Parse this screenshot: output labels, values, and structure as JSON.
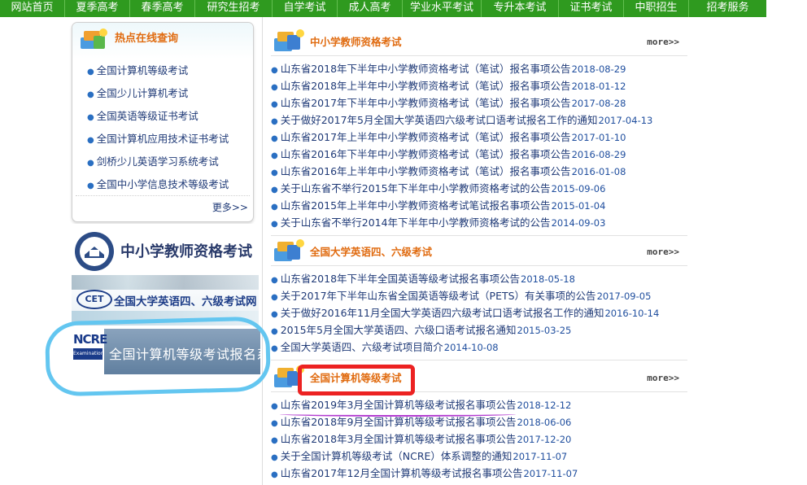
{
  "nav": {
    "items": [
      "网站首页",
      "夏季高考",
      "春季高考",
      "研究生招考",
      "自学考试",
      "成人高考",
      "学业水平考试",
      "专升本考试",
      "证书考试",
      "中职招生",
      "招考服务"
    ]
  },
  "hot": {
    "title": "热点在线查询",
    "items": [
      "全国计算机等级考试",
      "全国少儿计算机考试",
      "全国英语等级证书考试",
      "全国计算机应用技术证书考试",
      "剑桥少儿英语学习系统考试",
      "全国中小学信息技术等级考试"
    ],
    "more": "更多>>"
  },
  "banners": {
    "teacher": "中小学教师资格考试",
    "cet": "全国大学英语四、六级考试网",
    "cet_logo": "CET",
    "ncre": "全国计算机等级考试报名系统",
    "ncre_logo": "NCRE",
    "ncre_logo_sub": "Examination"
  },
  "sections": [
    {
      "title": "中小学教师资格考试",
      "more": "more>>",
      "items": [
        {
          "text": "山东省2018年下半年中小学教师资格考试（笔试）报名事项公告",
          "date": "2018-08-29"
        },
        {
          "text": "山东省2018年上半年中小学教师资格考试（笔试）报名事项公告",
          "date": "2018-01-12"
        },
        {
          "text": "山东省2017年下半年中小学教师资格考试（笔试）报名事项公告",
          "date": "2017-08-28"
        },
        {
          "text": "关于做好2017年5月全国大学英语四六级考试口语考试报名工作的通知",
          "date": "2017-04-13"
        },
        {
          "text": "山东省2017年上半年中小学教师资格考试（笔试）报名事项公告",
          "date": "2017-01-10"
        },
        {
          "text": "山东省2016年下半年中小学教师资格考试（笔试）报名事项公告",
          "date": "2016-08-29"
        },
        {
          "text": "山东省2016年上半年中小学教师资格考试（笔试）报名事项公告",
          "date": "2016-01-08"
        },
        {
          "text": "关于山东省不举行2015年下半年中小学教师资格考试的公告",
          "date": "2015-09-06"
        },
        {
          "text": "山东省2015年上半年中小学教师资格考试笔试报名事项公告",
          "date": "2015-01-04"
        },
        {
          "text": "关于山东省不举行2014年下半年中小学教师资格考试的公告",
          "date": "2014-09-03"
        }
      ]
    },
    {
      "title": "全国大学英语四、六级考试",
      "more": "more>>",
      "items": [
        {
          "text": "山东省2018年下半年全国英语等级考试报名事项公告",
          "date": "2018-05-18"
        },
        {
          "text": "关于2017年下半年山东省全国英语等级考试（PETS）有关事项的公告",
          "date": "2017-09-05"
        },
        {
          "text": "关于做好2016年11月全国大学英语四六级考试口语考试报名工作的通知",
          "date": "2016-10-14"
        },
        {
          "text": "2015年5月全国大学英语四、六级口语考试报名通知",
          "date": "2015-03-25"
        },
        {
          "text": "全国大学英语四、六级考试项目简介",
          "date": "2014-10-08"
        }
      ]
    },
    {
      "title": "全国计算机等级考试",
      "more": "more>>",
      "items": [
        {
          "text": "山东省2019年3月全国计算机等级考试报名事项公告",
          "date": "2018-12-12"
        },
        {
          "text": "山东省2018年9月全国计算机等级考试报名事项公告",
          "date": "2018-06-06"
        },
        {
          "text": "山东省2018年3月全国计算机等级考试报名事项公告",
          "date": "2017-12-20"
        },
        {
          "text": "关于全国计算机等级考试（NCRE）体系调整的通知",
          "date": "2017-11-07"
        },
        {
          "text": "山东省2017年12月全国计算机等级考试报名事项公告",
          "date": "2017-11-07"
        }
      ]
    }
  ],
  "colors": {
    "nav_bg": "#2f9a1f",
    "title_orange": "#e06b10",
    "link_blue": "#1f3a77",
    "annotation_blue": "#63c6f0",
    "annotation_red": "#ec2222",
    "annotation_purple": "#b23bd0"
  }
}
